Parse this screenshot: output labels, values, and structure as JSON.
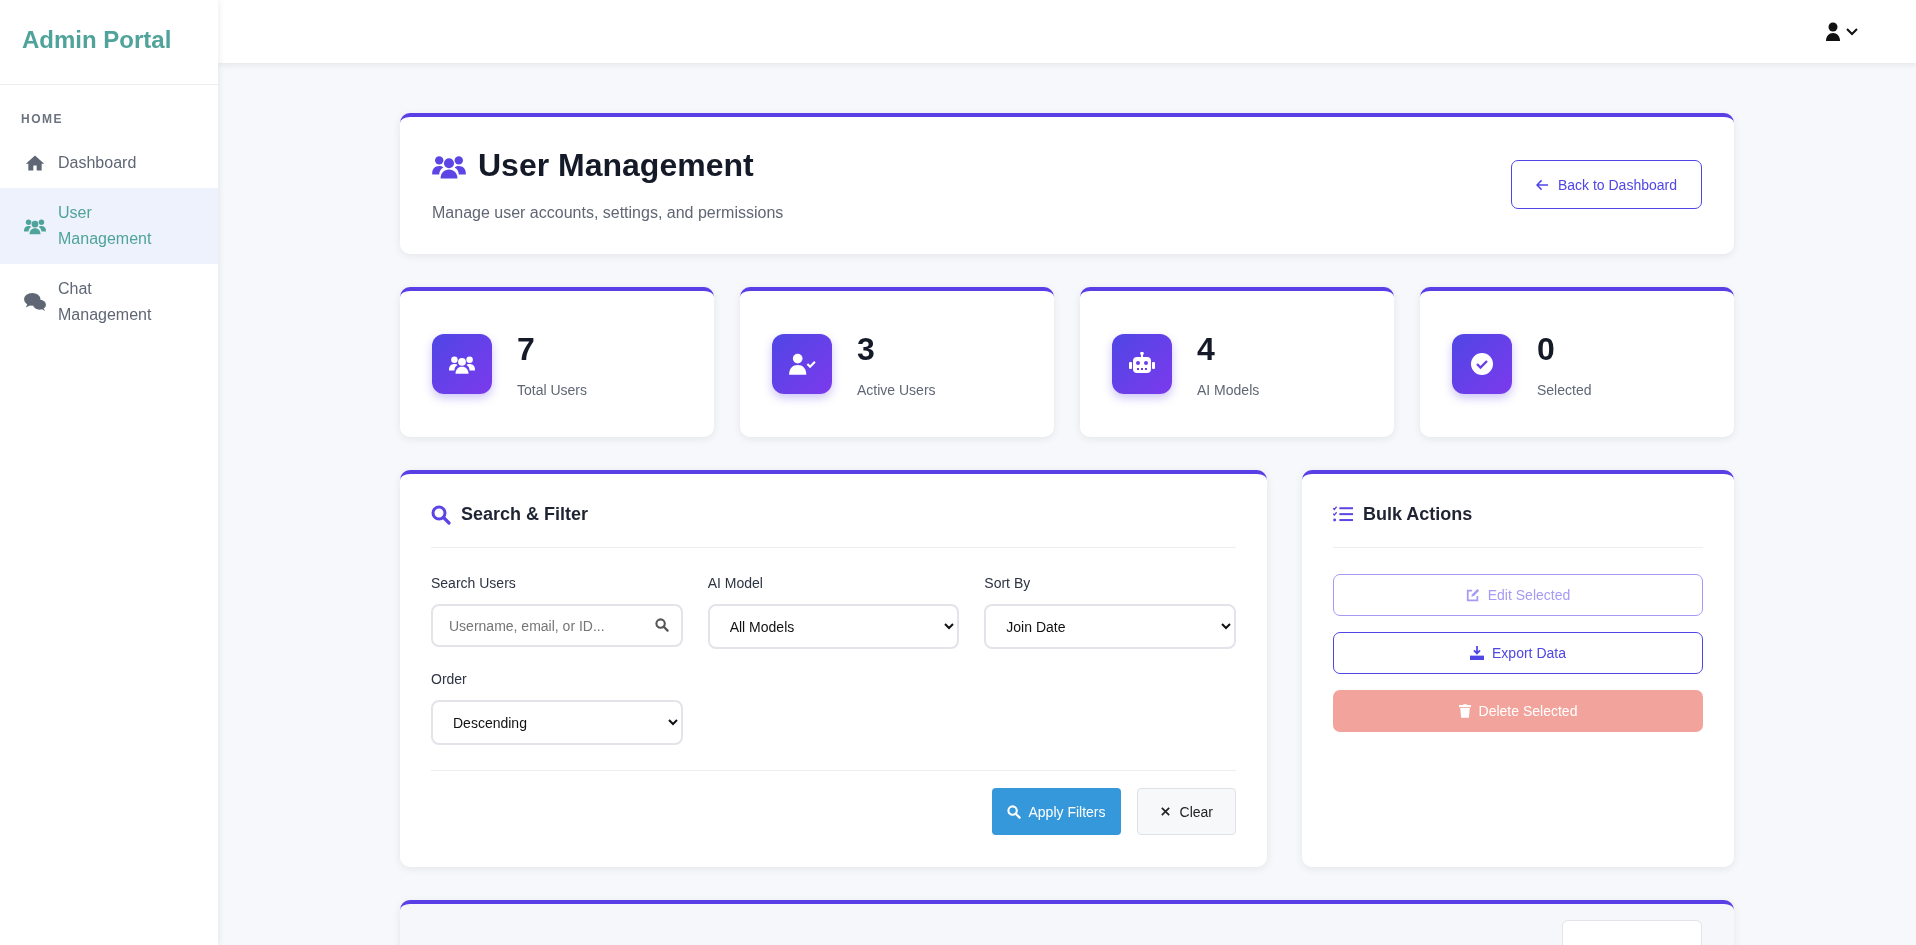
{
  "sidebar": {
    "brand": "Admin Portal",
    "section": "HOME",
    "items": [
      {
        "label": "Dashboard",
        "kind": "home",
        "selected": false
      },
      {
        "label": "User Management",
        "kind": "users",
        "selected": true
      },
      {
        "label": "Chat Management",
        "kind": "chat",
        "selected": false
      }
    ]
  },
  "header": {
    "title": "User Management",
    "subtitle": "Manage user accounts, settings, and permissions",
    "back_button": "Back to Dashboard"
  },
  "stats": [
    {
      "value": "7",
      "label": "Total Users",
      "kind": "users"
    },
    {
      "value": "3",
      "label": "Active Users",
      "kind": "active"
    },
    {
      "value": "4",
      "label": "AI Models",
      "kind": "models"
    },
    {
      "value": "0",
      "label": "Selected",
      "kind": "selected"
    }
  ],
  "filter": {
    "title": "Search & Filter",
    "fields": [
      {
        "label": "Search Users",
        "kind": "search",
        "placeholder": "Username, email, or ID..."
      },
      {
        "label": "AI Model",
        "kind": "select",
        "value": "All Models"
      },
      {
        "label": "Sort By",
        "kind": "select",
        "value": "Join Date"
      },
      {
        "label": "Order",
        "kind": "select",
        "value": "Descending"
      }
    ],
    "apply_button": "Apply Filters",
    "clear_button": "Clear"
  },
  "bulk": {
    "title": "Bulk Actions",
    "actions": [
      {
        "label": "Edit Selected",
        "kind": "edit",
        "disabled": true
      },
      {
        "label": "Export Data",
        "kind": "export",
        "disabled": false
      },
      {
        "label": "Delete Selected",
        "kind": "delete",
        "disabled": true
      }
    ]
  }
}
